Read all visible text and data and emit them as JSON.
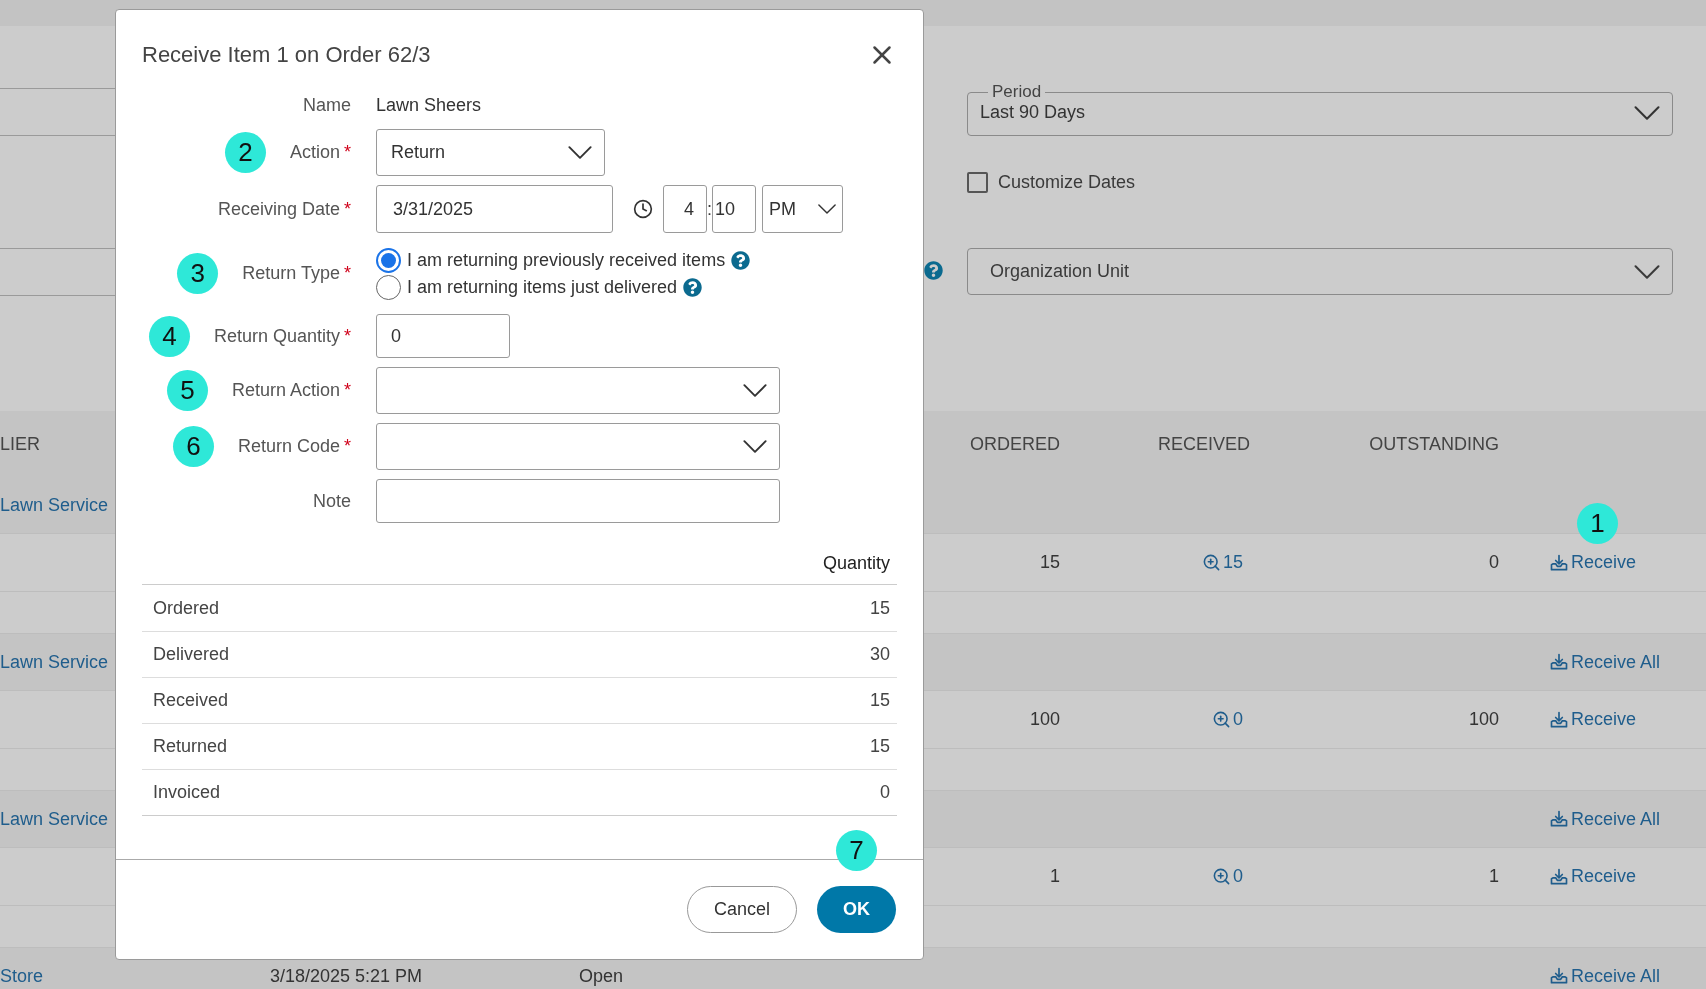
{
  "filters": {
    "period": {
      "label": "Period",
      "value": "Last 90 Days"
    },
    "customize_dates": {
      "label": "Customize Dates",
      "checked": false
    },
    "organization_unit": {
      "placeholder": "Organization Unit"
    }
  },
  "table": {
    "columns": {
      "column_1": "LIER",
      "ordered": "ORDERED",
      "received": "RECEIVED",
      "outstanding": "OUTSTANDING"
    },
    "rows": [
      {
        "kind": "group",
        "supplier": "Lawn Service"
      },
      {
        "kind": "item",
        "ordered": "15",
        "received": "15",
        "outstanding": "0",
        "action": "Receive",
        "annotation": "1"
      },
      {
        "kind": "group",
        "supplier": "Lawn Service",
        "action": "Receive All"
      },
      {
        "kind": "item",
        "ordered": "100",
        "received": "0",
        "outstanding": "100",
        "action": "Receive"
      },
      {
        "kind": "group",
        "supplier": "Lawn Service",
        "action": "Receive All"
      },
      {
        "kind": "item",
        "ordered": "1",
        "received": "0",
        "outstanding": "1",
        "action": "Receive"
      },
      {
        "kind": "group",
        "supplier": "Store",
        "date": "3/18/2025 5:21 PM",
        "status": "Open",
        "action": "Receive All"
      }
    ]
  },
  "dialog": {
    "title": "Receive Item 1 on Order 62/3",
    "required_mark": "*",
    "fields": [
      {
        "kind": "text",
        "label": "Name",
        "required": false,
        "value": "Lawn Sheers"
      },
      {
        "kind": "compact-select",
        "label": "Action",
        "required": true,
        "value": "Return",
        "annotation": "2"
      },
      {
        "kind": "datetime",
        "label": "Receiving Date",
        "required": true,
        "date": "3/31/2025",
        "hour": "4",
        "separator": ":",
        "minute": "10",
        "period": "PM"
      },
      {
        "kind": "radio",
        "label": "Return Type",
        "required": true,
        "annotation": "3",
        "options": [
          {
            "label": "I am returning previously received items",
            "selected": true
          },
          {
            "label": "I am returning items just delivered",
            "selected": false
          }
        ]
      },
      {
        "kind": "number",
        "label": "Return Quantity",
        "required": true,
        "value": "0",
        "annotation": "4"
      },
      {
        "kind": "select",
        "label": "Return Action",
        "required": true,
        "annotation": "5"
      },
      {
        "kind": "select",
        "label": "Return Code",
        "required": true,
        "annotation": "6"
      },
      {
        "kind": "input",
        "label": "Note",
        "required": false
      }
    ],
    "quantity_table": {
      "heading": "Quantity",
      "rows": [
        {
          "label": "Ordered",
          "value": "15"
        },
        {
          "label": "Delivered",
          "value": "30"
        },
        {
          "label": "Received",
          "value": "15"
        },
        {
          "label": "Returned",
          "value": "15"
        },
        {
          "label": "Invoiced",
          "value": "0"
        }
      ]
    },
    "buttons": [
      {
        "kind": "secondary",
        "label": "Cancel"
      },
      {
        "kind": "primary",
        "label": "OK",
        "annotation": "7"
      }
    ]
  }
}
